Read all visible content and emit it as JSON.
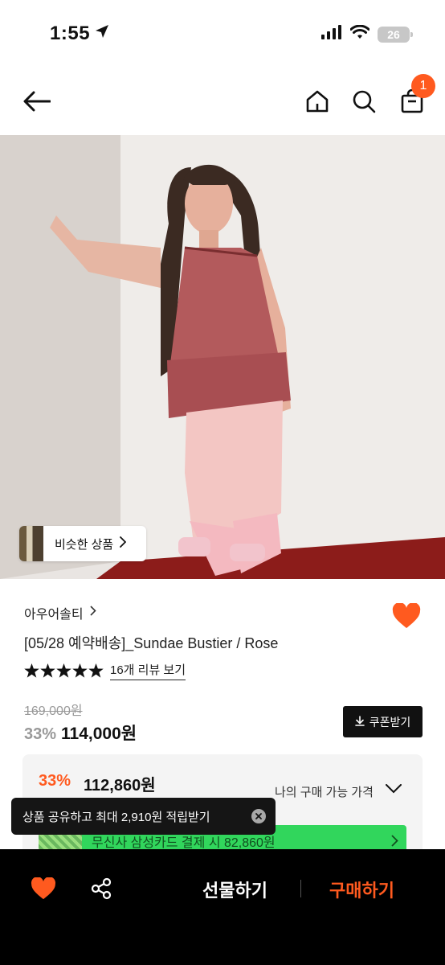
{
  "status_bar": {
    "time": "1:55",
    "battery": "26"
  },
  "header": {
    "cart_count": "1"
  },
  "product": {
    "similar_label": "비슷한 상품",
    "brand": "아우어솔티",
    "title": "[05/28 예약배송]_Sundae Bustier / Rose",
    "rating_stars": 5,
    "review_link": "16개 리뷰 보기",
    "original_price": "169,000원",
    "discount_rate": "33%",
    "sale_price": "114,000원",
    "coupon_label": "쿠폰받기"
  },
  "my_price": {
    "discount_rate": "33%",
    "price": "112,860원",
    "label": "나의 구매 가능 가격",
    "card_banner": "무신사 삼성카드 결제 시 82,860원"
  },
  "toast": {
    "text": "상품 공유하고 최대 2,910원 적립받기"
  },
  "bottom_bar": {
    "gift_label": "선물하기",
    "buy_label": "구매하기"
  },
  "colors": {
    "accent": "#ff5a1f",
    "bar_bg": "#000000",
    "banner": "#31d65c"
  },
  "icons": [
    "back-arrow-icon",
    "home-icon",
    "search-icon",
    "shopping-bag-icon",
    "heart-icon",
    "star-icon",
    "download-icon",
    "share-icon",
    "close-icon",
    "chevron-right-icon",
    "chevron-down-icon"
  ]
}
